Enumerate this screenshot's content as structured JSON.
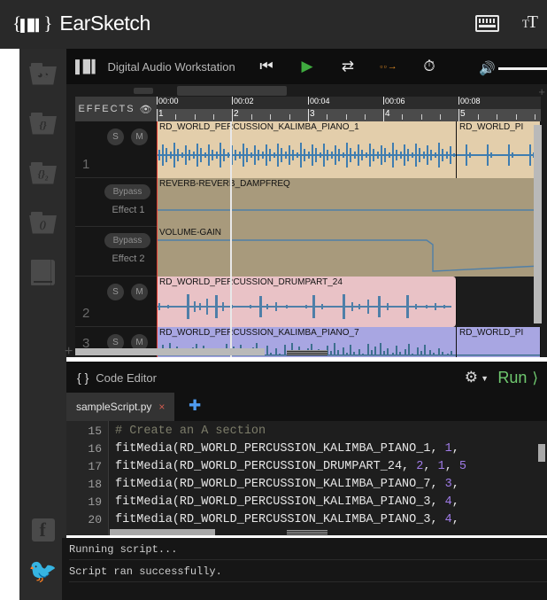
{
  "app": {
    "title": "EarSketch",
    "logo_glyph": "{ }",
    "keyboard_icon": "keyboard-shortcuts-icon",
    "font_icon": "font-size-icon"
  },
  "sidebar": {
    "items": [
      {
        "name": "sound-browser",
        "glyph": "♫",
        "icon": "folder-headphones-icon"
      },
      {
        "name": "script-browser",
        "glyph": "{}",
        "icon": "folder-braces-icon"
      },
      {
        "name": "script-history-browser",
        "glyph": "{}₂",
        "icon": "folder-braces-2-icon"
      },
      {
        "name": "api-browser",
        "glyph": "()",
        "icon": "folder-parens-icon"
      },
      {
        "name": "curriculum",
        "glyph": "",
        "icon": "book-icon"
      }
    ],
    "social": [
      {
        "name": "facebook",
        "label": "f",
        "icon": "facebook-icon"
      },
      {
        "name": "twitter",
        "label": "🐦",
        "icon": "twitter-icon"
      }
    ]
  },
  "daw": {
    "title": "Digital Audio Workstation",
    "wave_icon": "waveform-icon",
    "transport": [
      {
        "name": "rewind",
        "glyph": "⏮",
        "color": "#e9e9e9"
      },
      {
        "name": "play",
        "glyph": "▶",
        "color": "#3faa3f"
      },
      {
        "name": "loop",
        "glyph": "↻",
        "color": "#e9e9e9"
      },
      {
        "name": "follow-playhead",
        "glyph": "→",
        "color": "#e08a23"
      },
      {
        "name": "metronome",
        "glyph": "ⓘ",
        "color": "#e9e9e9"
      }
    ],
    "volume": {
      "icon": "speaker-icon",
      "value": 100
    },
    "effects_label": "EFFECTS",
    "eye_icon": "eye-icon",
    "timeline": {
      "times": [
        "00:00",
        "00:02",
        "00:04",
        "00:06",
        "00:08"
      ],
      "bars": [
        "1",
        "2",
        "3",
        "4",
        "5"
      ]
    },
    "tracks": [
      {
        "number": "1",
        "kind": "audio",
        "solo": "S",
        "mute": "M",
        "clips": [
          {
            "label": "RD_WORLD_PERCUSSION_KALIMBA_PIANO_1",
            "color": "#e3ceab",
            "start": 0,
            "len": 339
          },
          {
            "label": "RD_WORLD_PI",
            "color": "#e3ceab",
            "start": 339,
            "len": 95
          }
        ]
      },
      {
        "number": "",
        "kind": "effect",
        "bypass": "Bypass",
        "effect_label": "Effect 1",
        "clips": [
          {
            "label": "REVERB-REVERB_DAMPFREQ",
            "color": "#a89a7c",
            "start": 0,
            "len": 434
          }
        ]
      },
      {
        "number": "",
        "kind": "effect",
        "bypass": "Bypass",
        "effect_label": "Effect 2",
        "clips": [
          {
            "label": "VOLUME-GAIN",
            "color": "#a89a7c",
            "start": 0,
            "len": 434
          }
        ]
      },
      {
        "number": "2",
        "kind": "audio",
        "solo": "S",
        "mute": "M",
        "clips": [
          {
            "label": "RD_WORLD_PERCUSSION_DRUMPART_24",
            "color": "#e9c2c6",
            "start": 0,
            "len": 339
          }
        ]
      },
      {
        "number": "3",
        "kind": "audio",
        "solo": "S",
        "mute": "M",
        "clips": [
          {
            "label": "RD_WORLD_PERCUSSION_KALIMBA_PIANO_7",
            "color": "#a8a6e2",
            "start": 0,
            "len": 339
          },
          {
            "label": "RD_WORLD_PI",
            "color": "#a8a6e2",
            "start": 339,
            "len": 95
          }
        ]
      }
    ],
    "add_track_icon": "plus-icon"
  },
  "editor": {
    "title": "Code Editor",
    "braces_icon": "braces-icon",
    "settings_icon": "gear-icon",
    "dropdown_icon": "chevron-down-icon",
    "run_label": "Run",
    "run_icon": "chevron-right-icon",
    "tab": {
      "name": "sampleScript.py",
      "close": "×"
    },
    "add_tab_icon": "plus-icon",
    "lines": [
      {
        "n": "15",
        "text": "# Create an A section",
        "type": "comment"
      },
      {
        "n": "16",
        "code": "fitMedia(RD_WORLD_PERCUSSION_KALIMBA_PIANO_1, 1,"
      },
      {
        "n": "17",
        "code": "fitMedia(RD_WORLD_PERCUSSION_DRUMPART_24, 2, 1, 5"
      },
      {
        "n": "18",
        "code": "fitMedia(RD_WORLD_PERCUSSION_KALIMBA_PIANO_7, 3,"
      },
      {
        "n": "19",
        "code": "fitMedia(RD_WORLD_PERCUSSION_KALIMBA_PIANO_3, 4,"
      },
      {
        "n": "20",
        "code": "fitMedia(RD_WORLD_PERCUSSION_KALIMBA_PIANO_3, 4,"
      }
    ]
  },
  "console": {
    "lines": [
      "Running script...",
      "Script ran successfully."
    ]
  }
}
